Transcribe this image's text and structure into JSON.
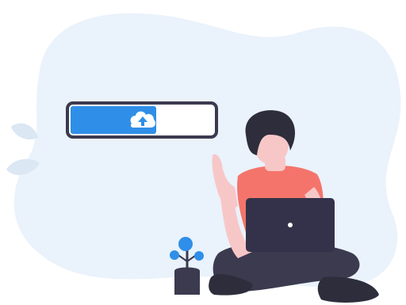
{
  "illustration": {
    "subject": "person-with-laptop-uploading",
    "upload_bar": {
      "progress_fraction": 0.6,
      "icon": "cloud-upload-icon"
    },
    "colors": {
      "blob_background": "#eaf2fb",
      "leaf": "#dbe7f3",
      "accent_blue": "#2f8fe8",
      "dark_navy": "#3b3a4f",
      "shirt": "#f4746b",
      "skin": "#f7c7c7",
      "hair": "#2e2d3c",
      "pants": "#3b3a4f",
      "laptop": "#34324a",
      "bar_empty": "#ffffff"
    }
  }
}
